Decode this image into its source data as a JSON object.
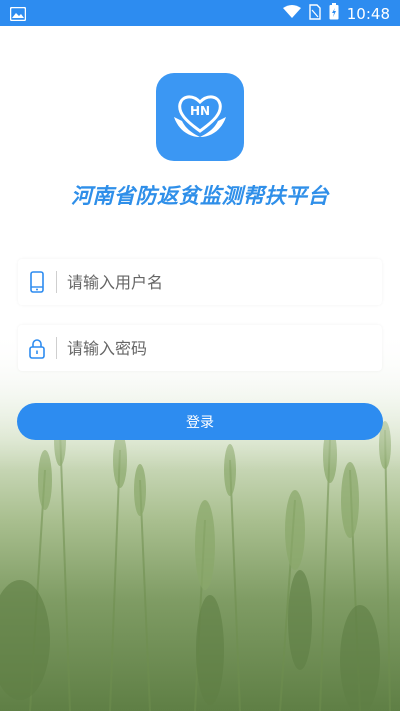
{
  "status_bar": {
    "time": "10:48",
    "icons": [
      "image-icon",
      "wifi-icon",
      "sim-icon",
      "battery-icon"
    ]
  },
  "app": {
    "logo_text": "HN",
    "title": "河南省防返贫监测帮扶平台"
  },
  "form": {
    "username_placeholder": "请输入用户名",
    "username_value": "",
    "password_placeholder": "请输入密码",
    "password_value": "",
    "login_label": "登录"
  },
  "colors": {
    "primary": "#2d8cf0",
    "title": "#2f8fe9"
  }
}
